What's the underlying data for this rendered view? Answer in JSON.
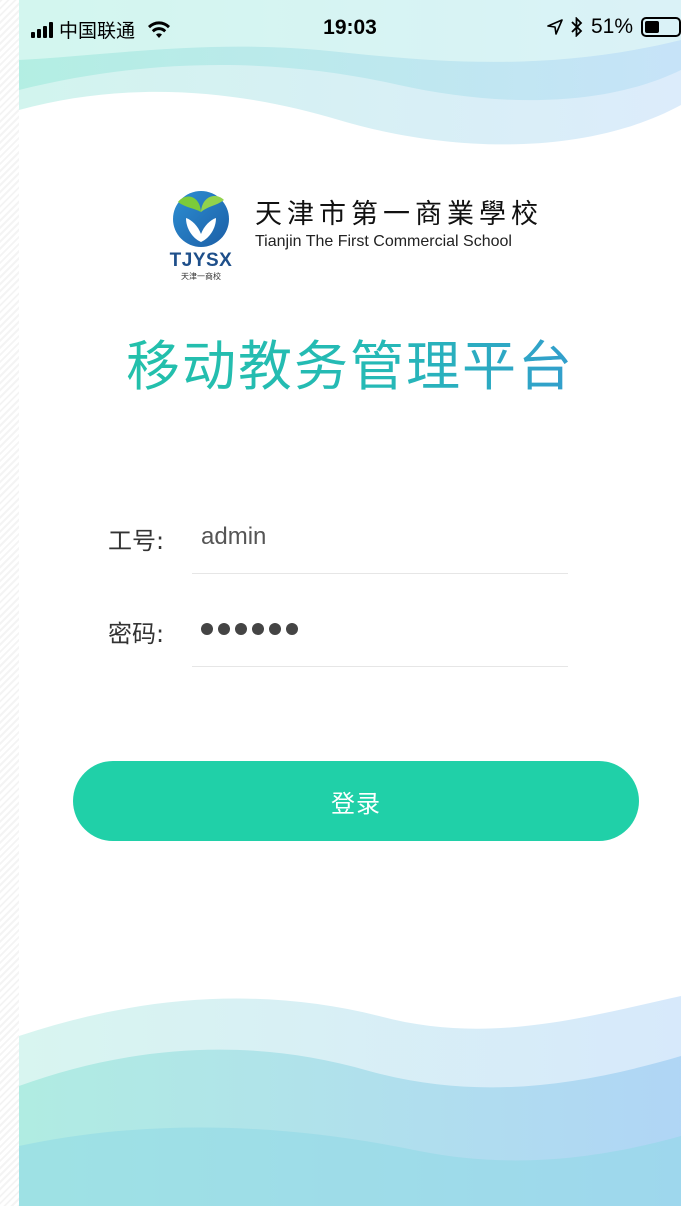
{
  "status_bar": {
    "carrier": "中国联通",
    "time": "19:03",
    "battery_percent": "51%",
    "battery_level": 0.51,
    "icons": [
      "signal-icon",
      "wifi-icon",
      "location-arrow-icon",
      "bluetooth-icon",
      "battery-icon"
    ]
  },
  "logo": {
    "abbr": "TJYSX",
    "abbr_cn": "天津一商校",
    "name_cn": "天津市第一商業學校",
    "name_en": "Tianjin The First Commercial School"
  },
  "app_title": "移动教务管理平台",
  "form": {
    "username_label": "工号:",
    "username_value": "admin",
    "password_label": "密码:",
    "password_mask_length": 6
  },
  "login_button": "登录",
  "colors": {
    "accent": "#20d0a8",
    "title_start": "#22c3a6",
    "title_end": "#3a8fd9"
  }
}
